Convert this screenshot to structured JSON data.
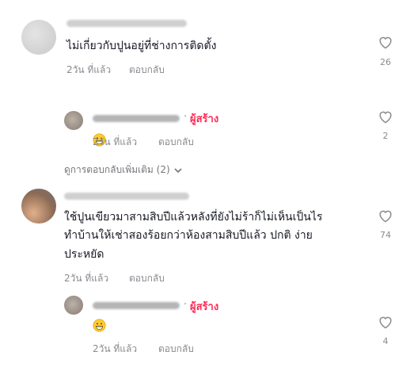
{
  "comments": [
    {
      "text": "ไม่เกี่ยวกับปูนอยู่ที่ช่างการติดตั้ง",
      "time": "2วัน ที่แล้ว",
      "reply_label": "ตอบกลับ",
      "likes": "26",
      "reply": {
        "creator_label": "ผู้สร้าง",
        "separator": "·",
        "emoji": "grinning-face",
        "time": "2วัน ที่แล้ว",
        "reply_label": "ตอบกลับ",
        "likes": "2"
      }
    },
    {
      "text_line1": "ใช้ปูนเขียวมาสามสิบปีแล้วหลังที่ยังไม่ร้าก็ไม่เห็นเป็นไร",
      "text_line2": "ทำบ้านให้เช่าสองร้อยกว่าห้องสามสิบปีแล้ว ปกติ ง่าย",
      "text_line3": "ประหยัด",
      "time": "2วัน ที่แล้ว",
      "reply_label": "ตอบกลับ",
      "likes": "74",
      "reply": {
        "creator_label": "ผู้สร้าง",
        "separator": "·",
        "emoji": "grinning-face",
        "time": "2วัน ที่แล้ว",
        "reply_label": "ตอบกลับ",
        "likes": "4"
      }
    }
  ],
  "view_more_replies": "ดูการตอบกลับเพิ่มเติม (2)",
  "colors": {
    "creator": "#fe2c55",
    "meta": "#8a8b91",
    "text": "#161823"
  }
}
